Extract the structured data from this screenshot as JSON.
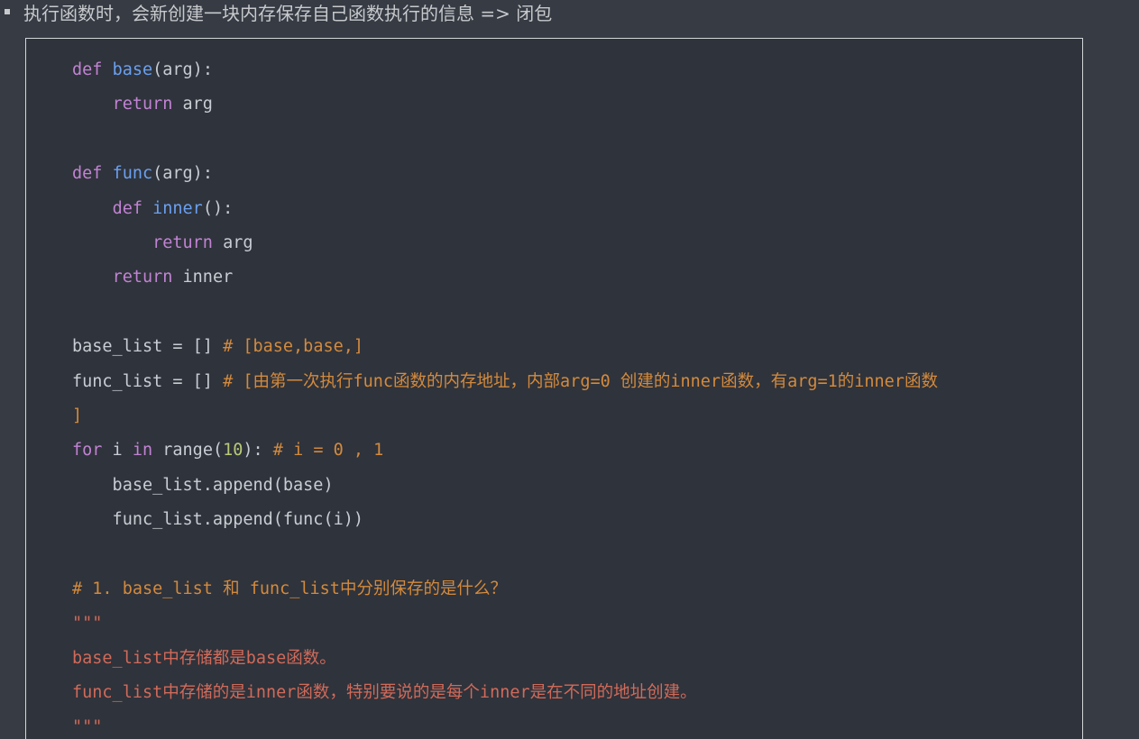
{
  "header": {
    "bullet_text": "执行函数时，会新创建一块内存保存自己函数执行的信息 => 闭包"
  },
  "code": {
    "language": "python",
    "lines": [
      [
        {
          "t": "def",
          "c": "kw"
        },
        {
          "t": " "
        },
        {
          "t": "base",
          "c": "fn"
        },
        {
          "t": "(arg):"
        }
      ],
      [
        {
          "t": "    "
        },
        {
          "t": "return",
          "c": "kw"
        },
        {
          "t": " arg"
        }
      ],
      [],
      [
        {
          "t": "def",
          "c": "kw"
        },
        {
          "t": " "
        },
        {
          "t": "func",
          "c": "fn"
        },
        {
          "t": "(arg):"
        }
      ],
      [
        {
          "t": "    "
        },
        {
          "t": "def",
          "c": "kw"
        },
        {
          "t": " "
        },
        {
          "t": "inner",
          "c": "fn"
        },
        {
          "t": "():"
        }
      ],
      [
        {
          "t": "        "
        },
        {
          "t": "return",
          "c": "kw"
        },
        {
          "t": " arg"
        }
      ],
      [
        {
          "t": "    "
        },
        {
          "t": "return",
          "c": "kw"
        },
        {
          "t": " inner"
        }
      ],
      [],
      [
        {
          "t": "base_list = [] "
        },
        {
          "t": "# [base,base,]",
          "c": "cm"
        }
      ],
      [
        {
          "t": "func_list = [] "
        },
        {
          "t": "# [由第一次执行func函数的内存地址，内部arg=0 创建的inner函数，有arg=1的inner函数",
          "c": "cm"
        }
      ],
      [
        {
          "t": "]",
          "c": "cm"
        }
      ],
      [
        {
          "t": "for",
          "c": "kw"
        },
        {
          "t": " i "
        },
        {
          "t": "in",
          "c": "kw"
        },
        {
          "t": " range"
        },
        {
          "t": "("
        },
        {
          "t": "10",
          "c": "num"
        },
        {
          "t": "): "
        },
        {
          "t": "# i = 0 , 1",
          "c": "cm"
        }
      ],
      [
        {
          "t": "    base_list.append(base)"
        }
      ],
      [
        {
          "t": "    func_list.append(func(i))"
        }
      ],
      [],
      [
        {
          "t": "# 1. base_list 和 func_list中分别保存的是什么？",
          "c": "cm"
        }
      ],
      [
        {
          "t": "\"\"\"",
          "c": "ds"
        }
      ],
      [
        {
          "t": "base_list中存储都是base函数。",
          "c": "ds"
        }
      ],
      [
        {
          "t": "func_list中存储的是inner函数，特别要说的是每个inner是在不同的地址创建。",
          "c": "ds"
        }
      ],
      [
        {
          "t": "\"\"\"",
          "c": "ds"
        }
      ]
    ]
  },
  "colors": {
    "background": "#363b44",
    "code_background": "#2f333b",
    "keyword": "#c183d3",
    "function_name": "#6aa0f0",
    "comment": "#d38a3d",
    "number": "#b8c977",
    "docstring": "#d06a5a",
    "plain": "#c8ccd3"
  }
}
